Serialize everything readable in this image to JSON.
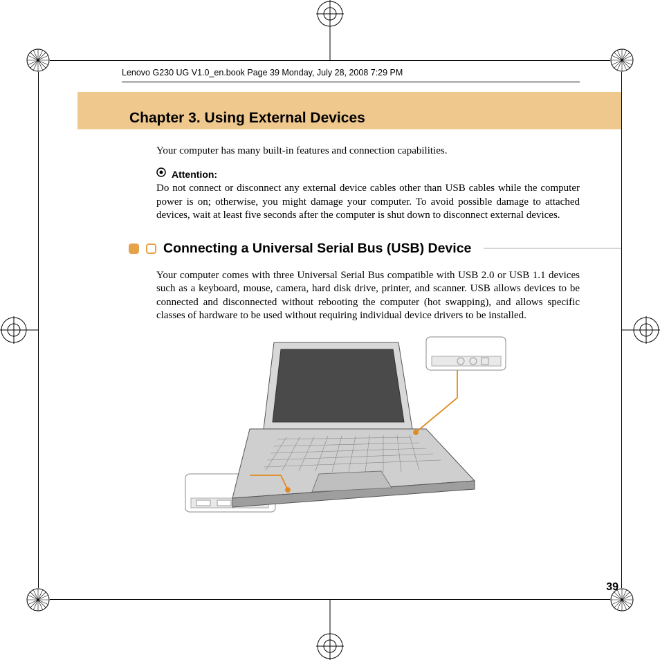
{
  "meta": {
    "header_line": "Lenovo G230 UG V1.0_en.book  Page 39  Monday, July 28, 2008  7:29 PM"
  },
  "chapter": {
    "title": "Chapter 3. Using External Devices"
  },
  "intro": "Your computer has many built-in features and connection capabilities.",
  "attention": {
    "label": "Attention:",
    "text": "Do not connect or disconnect any external device cables other than USB cables while the computer power is on; otherwise, you might damage your computer. To avoid possible damage to attached devices, wait at least five seconds after the computer is shut down to disconnect external devices."
  },
  "section": {
    "title": "Connecting a Universal Serial Bus (USB) Device",
    "text": "Your computer comes with three Universal Serial Bus compatible with USB 2.0 or USB 1.1 devices such as a keyboard, mouse, camera, hard disk drive, printer, and scanner. USB allows devices to be connected and disconnected without rebooting the computer (hot swapping), and allows specific classes of hardware to be used without requiring individual device drivers to be installed."
  },
  "page_number": "39"
}
